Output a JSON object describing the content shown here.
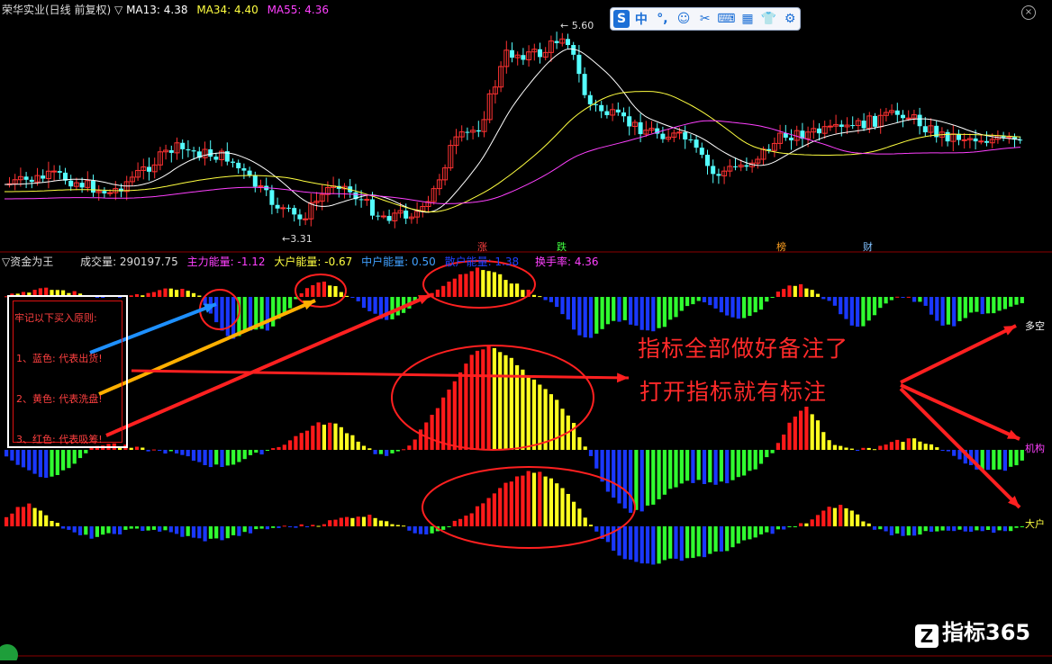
{
  "window": {
    "title": "荣华实业(日线 前复权)",
    "menu_arrow": "▽"
  },
  "price_header": {
    "ma13": {
      "label": "MA13: 4.38",
      "color": "#ffffff"
    },
    "ma34": {
      "label": "MA34: 4.40",
      "color": "#ffff40"
    },
    "ma55": {
      "label": "MA55: 4.36",
      "color": "#ff40ff"
    }
  },
  "price_marks": {
    "high": "5.60",
    "low": "3.31"
  },
  "events": [
    {
      "label": "涨",
      "color": "#ff4040"
    },
    {
      "label": "跌",
      "color": "#40ff40"
    },
    {
      "label": "榜",
      "color": "#ffa020"
    },
    {
      "label": "财",
      "color": "#80c0ff"
    }
  ],
  "indicator_header": {
    "name": "▽资金为王",
    "volume": {
      "label": "成交量: 290197.75",
      "color": "#dddddd"
    },
    "main_force": {
      "label": "主力能量: -1.12",
      "color": "#ff40ff"
    },
    "big_players": {
      "label": "大户能量: -0.67",
      "color": "#ffff40"
    },
    "mid_players": {
      "label": "中户能量: 0.50",
      "color": "#40a0ff"
    },
    "retail": {
      "label": "散户能量: 1.38",
      "color": "#2040ff"
    },
    "turnover": {
      "label": "换手率: 4.36",
      "color": "#ff40ff"
    }
  },
  "annotations": {
    "rules_title": "牢记以下买入原则:",
    "rule_blue": "1、蓝色: 代表出货!",
    "rule_yellow": "2、黄色: 代表洗盘!",
    "rule_red": "3、红色: 代表吸筹!",
    "banner_line1": "指标全部做好备注了",
    "banner_line2": "打开指标就有标注"
  },
  "side_labels": {
    "long_short": {
      "label": "多空",
      "color": "#ffffff"
    },
    "institution": {
      "label": "机构",
      "color": "#ff40ff"
    },
    "big_player": {
      "label": "大户",
      "color": "#ffff40"
    }
  },
  "watermark": {
    "badge": "Z",
    "text": "指标365"
  },
  "toolbar": {
    "items": [
      {
        "name": "ime-logo-icon",
        "glyph": "S"
      },
      {
        "name": "chinese-mode-icon",
        "glyph": "中"
      },
      {
        "name": "punctuation-icon",
        "glyph": "°,"
      },
      {
        "name": "emoji-icon",
        "glyph": "☺"
      },
      {
        "name": "scissors-icon",
        "glyph": "✂"
      },
      {
        "name": "keyboard-icon",
        "glyph": "⌨"
      },
      {
        "name": "grid-icon",
        "glyph": "▦"
      },
      {
        "name": "shirt-icon",
        "glyph": "👕"
      },
      {
        "name": "gear-icon",
        "glyph": "⚙"
      }
    ]
  },
  "colors": {
    "up": "#ff3232",
    "down": "#54ffff",
    "red": "#ff1a1a",
    "yellow": "#ffff20",
    "blue": "#1a38ff",
    "green": "#30ff30",
    "arrow_blue": "#1e90ff",
    "arrow_orange": "#ffb000",
    "arrow_red": "#ff2020"
  }
}
